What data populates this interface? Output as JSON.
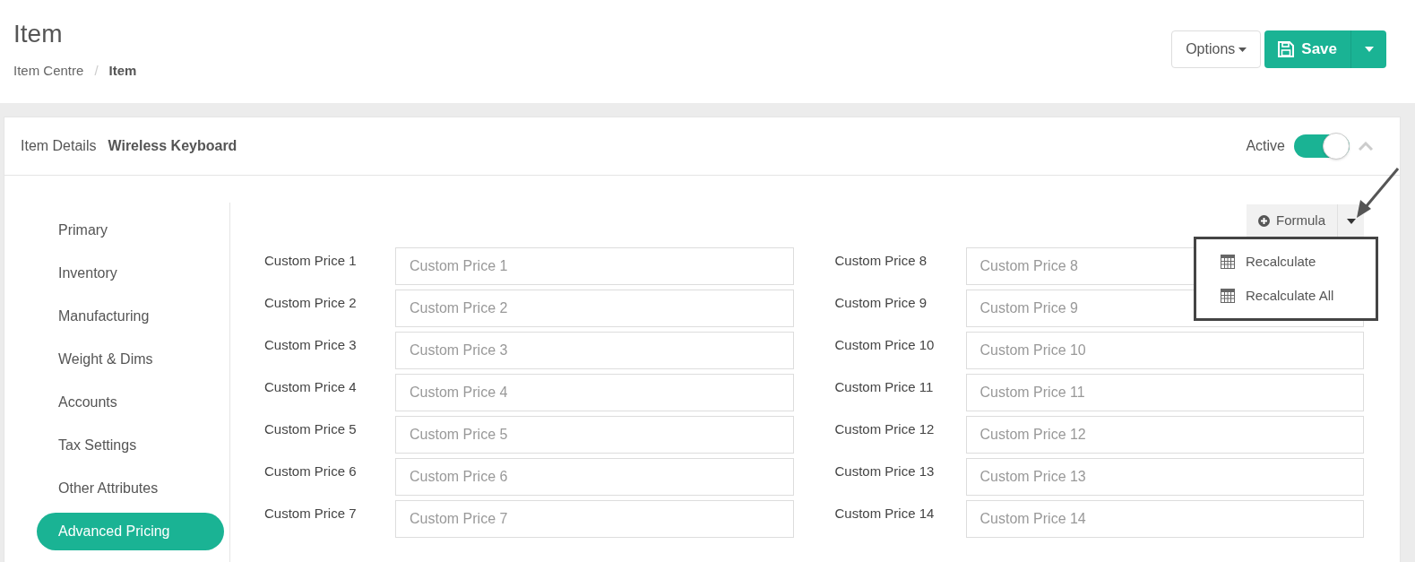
{
  "header": {
    "title": "Item",
    "breadcrumb": [
      {
        "label": "Item Centre",
        "current": false
      },
      {
        "label": "Item",
        "current": true
      }
    ],
    "breadcrumb_separator": "/",
    "options_button": "Options",
    "save_button": "Save"
  },
  "card": {
    "title": "Item Details",
    "item_name": "Wireless Keyboard",
    "active_toggle": {
      "label": "Active",
      "on": true
    }
  },
  "sidebar": {
    "items": [
      {
        "label": "Primary",
        "selected": false
      },
      {
        "label": "Inventory",
        "selected": false
      },
      {
        "label": "Manufacturing",
        "selected": false
      },
      {
        "label": "Weight & Dims",
        "selected": false
      },
      {
        "label": "Accounts",
        "selected": false
      },
      {
        "label": "Tax Settings",
        "selected": false
      },
      {
        "label": "Other Attributes",
        "selected": false
      },
      {
        "label": "Advanced Pricing",
        "selected": true
      }
    ]
  },
  "formula_button": "Formula",
  "formula_menu": {
    "items": [
      "Recalculate",
      "Recalculate All"
    ]
  },
  "fields": [
    [
      {
        "label": "Custom Price 1",
        "placeholder": "Custom Price 1"
      },
      {
        "label": "Custom Price 2",
        "placeholder": "Custom Price 2"
      },
      {
        "label": "Custom Price 3",
        "placeholder": "Custom Price 3"
      },
      {
        "label": "Custom Price 4",
        "placeholder": "Custom Price 4"
      },
      {
        "label": "Custom Price 5",
        "placeholder": "Custom Price 5"
      },
      {
        "label": "Custom Price 6",
        "placeholder": "Custom Price 6"
      },
      {
        "label": "Custom Price 7",
        "placeholder": "Custom Price 7"
      }
    ],
    [
      {
        "label": "Custom Price 8",
        "placeholder": "Custom Price 8"
      },
      {
        "label": "Custom Price 9",
        "placeholder": "Custom Price 9"
      },
      {
        "label": "Custom Price 10",
        "placeholder": "Custom Price 10"
      },
      {
        "label": "Custom Price 11",
        "placeholder": "Custom Price 11"
      },
      {
        "label": "Custom Price 12",
        "placeholder": "Custom Price 12"
      },
      {
        "label": "Custom Price 13",
        "placeholder": "Custom Price 13"
      },
      {
        "label": "Custom Price 14",
        "placeholder": "Custom Price 14"
      }
    ]
  ]
}
